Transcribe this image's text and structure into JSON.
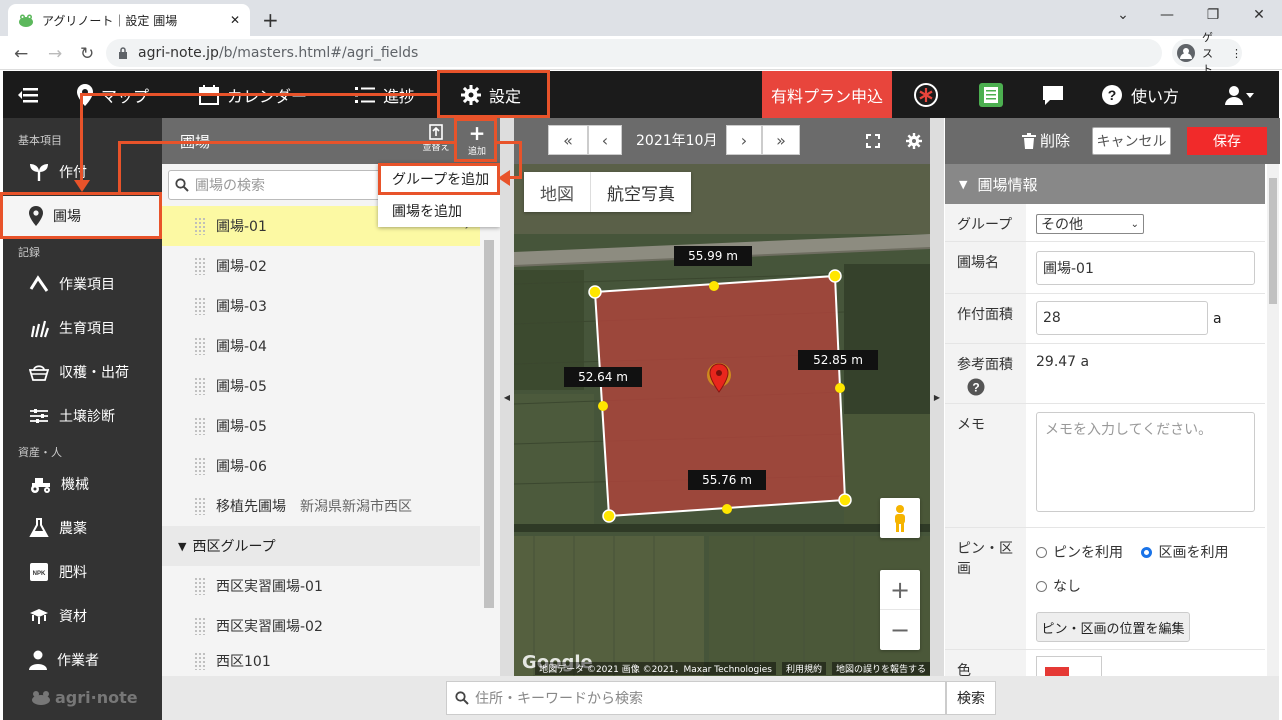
{
  "browser": {
    "tab_title": "アグリノート｜設定 圃場",
    "url_host": "agri-note.jp",
    "url_path": "/b/masters.html#/agri_fields",
    "profile_label": "ゲスト"
  },
  "topnav": {
    "items": [
      {
        "label": "マップ",
        "icon": "map-pin-icon"
      },
      {
        "label": "カレンダー",
        "icon": "calendar-icon"
      },
      {
        "label": "進捗",
        "icon": "list-icon"
      },
      {
        "label": "設定",
        "icon": "gear-icon"
      }
    ],
    "paid_plan": "有料プラン申込",
    "help": "使い方"
  },
  "sidebar": {
    "sections": [
      "基本項目",
      "記録",
      "資産・人"
    ],
    "items": [
      {
        "label": "作付",
        "icon": "sprout-icon"
      },
      {
        "label": "圃場",
        "icon": "location-icon",
        "active": true
      },
      {
        "label": "作業項目",
        "icon": "task-icon"
      },
      {
        "label": "生育項目",
        "icon": "growth-icon"
      },
      {
        "label": "収穫・出荷",
        "icon": "basket-icon"
      },
      {
        "label": "土壌診断",
        "icon": "sliders-icon"
      },
      {
        "label": "機械",
        "icon": "tractor-icon"
      },
      {
        "label": "農薬",
        "icon": "flask-icon"
      },
      {
        "label": "肥料",
        "icon": "fertilizer-icon"
      },
      {
        "label": "資材",
        "icon": "materials-icon"
      },
      {
        "label": "作業者",
        "icon": "person-icon"
      }
    ],
    "logo": "agri·note"
  },
  "field_list": {
    "title": "圃場",
    "sort_label": "並替え",
    "add_label": "追加",
    "search_placeholder": "圃場の検索",
    "fields": [
      "圃場-01",
      "圃場-02",
      "圃場-03",
      "圃場-04",
      "圃場-05",
      "圃場-05",
      "圃場-06"
    ],
    "relocated": {
      "name": "移植先圃場",
      "address": "新潟県新潟市西区"
    },
    "group_name": "西区グループ",
    "group_fields": [
      "西区実習圃場-01",
      "西区実習圃場-02",
      "西区101"
    ]
  },
  "add_menu": {
    "items": [
      "グループを追加",
      "圃場を追加"
    ]
  },
  "map": {
    "month": "2021年10月",
    "type_map": "地図",
    "type_satellite": "航空写真",
    "measurements": [
      "55.99 m",
      "52.85 m",
      "55.76 m",
      "52.64 m"
    ],
    "credits": "地図データ ©2021 画像 ©2021，Maxar Technologies",
    "terms": "利用規約",
    "report": "地図の誤りを報告する",
    "google": "Google",
    "zoom_in": "+",
    "zoom_out": "−"
  },
  "detail": {
    "delete": "削除",
    "cancel": "キャンセル",
    "save": "保存",
    "section_title": "圃場情報",
    "group_label": "グループ",
    "group_value": "その他",
    "name_label": "圃場名",
    "name_value": "圃場-01",
    "area_label": "作付面積",
    "area_value": "28",
    "area_unit": "a",
    "ref_area_label": "参考面積",
    "ref_area_value": "29.47 a",
    "memo_label": "メモ",
    "memo_placeholder": "メモを入力してください。",
    "pin_label": "ピン・区画",
    "pin_options": [
      "ピンを利用",
      "区画を利用",
      "なし"
    ],
    "pin_selected": "区画を利用",
    "edit_position": "ピン・区画の位置を編集",
    "color_label": "色"
  },
  "bottom_search": {
    "placeholder": "住所・キーワードから検索",
    "button": "検索"
  },
  "colors": {
    "annotation": "#e8532a",
    "paid_plan": "#e8453c",
    "save": "#f12a2a",
    "highlight_row": "#fcf9a3",
    "field_polygon": "#b5443c"
  }
}
